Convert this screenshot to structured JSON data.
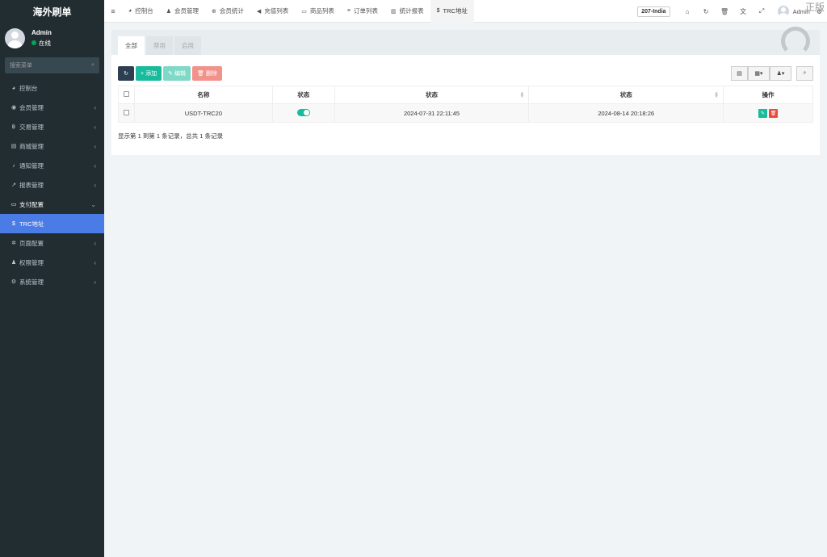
{
  "sidebar": {
    "brand": "海外刷单",
    "user": {
      "name": "Admin",
      "status": "在线"
    },
    "search_placeholder": "搜索菜单",
    "items": [
      {
        "icon": "dashboard-icon",
        "glyph": "◕",
        "label": "控制台",
        "chevron": ""
      },
      {
        "icon": "user-circle-icon",
        "glyph": "◉",
        "label": "会员管理",
        "chevron": "‹"
      },
      {
        "icon": "bitcoin-icon",
        "glyph": "฿",
        "label": "交易管理",
        "chevron": "‹"
      },
      {
        "icon": "shop-icon",
        "glyph": "▤",
        "label": "商城管理",
        "chevron": "‹"
      },
      {
        "icon": "bell-icon",
        "glyph": "♪",
        "label": "通知管理",
        "chevron": "‹"
      },
      {
        "icon": "chart-line-icon",
        "glyph": "↗",
        "label": "报表管理",
        "chevron": "‹"
      },
      {
        "icon": "credit-card-icon",
        "glyph": "▭",
        "label": "支付配置",
        "chevron": "⌄"
      },
      {
        "icon": "dollar-icon",
        "glyph": "$",
        "label": "TRC地址",
        "chevron": ""
      },
      {
        "icon": "gear-icon",
        "glyph": "✲",
        "label": "页面配置",
        "chevron": "‹"
      },
      {
        "icon": "users-icon",
        "glyph": "♟",
        "label": "权限管理",
        "chevron": "‹"
      },
      {
        "icon": "cogs-icon",
        "glyph": "⚙",
        "label": "系统管理",
        "chevron": "‹"
      }
    ]
  },
  "topbar": {
    "hamburger": "≡",
    "tabs": [
      {
        "icon": "dashboard-icon",
        "glyph": "◕",
        "label": "控制台"
      },
      {
        "icon": "user-icon",
        "glyph": "♟",
        "label": "会员管理"
      },
      {
        "icon": "globe-icon",
        "glyph": "⊕",
        "label": "会员统计"
      },
      {
        "icon": "volume-icon",
        "glyph": "◀",
        "label": "充值列表"
      },
      {
        "icon": "monitor-icon",
        "glyph": "▭",
        "label": "商品列表"
      },
      {
        "icon": "list-icon",
        "glyph": "≡",
        "label": "订单列表"
      },
      {
        "icon": "bar-chart-icon",
        "glyph": "▥",
        "label": "统计报表"
      },
      {
        "icon": "dollar-icon",
        "glyph": "$",
        "label": "TRC地址"
      }
    ],
    "server_badge": "207-India",
    "icons": [
      {
        "name": "home-icon",
        "glyph": "⌂"
      },
      {
        "name": "refresh-icon",
        "glyph": "↻"
      },
      {
        "name": "trash-icon",
        "glyph": "🗑"
      },
      {
        "name": "language-icon",
        "glyph": "文"
      },
      {
        "name": "fullscreen-icon",
        "glyph": "⤢"
      }
    ],
    "admin_name": "Admin",
    "watermark": "正版"
  },
  "content": {
    "filter_tabs": [
      "全部",
      "禁用",
      "启用"
    ],
    "buttons": {
      "refresh": "↻",
      "add": "添加",
      "edit": "编辑",
      "delete": "删除"
    },
    "table": {
      "headers": [
        "名称",
        "状态",
        "状态",
        "状态",
        "操作"
      ],
      "rows": [
        {
          "name": "USDT-TRC20",
          "enabled": true,
          "created": "2024-07-31 22:11:45",
          "updated": "2024-08-14 20:18:26"
        }
      ]
    },
    "pager_info": "显示第 1 到第 1 条记录，总共 1 条记录"
  }
}
